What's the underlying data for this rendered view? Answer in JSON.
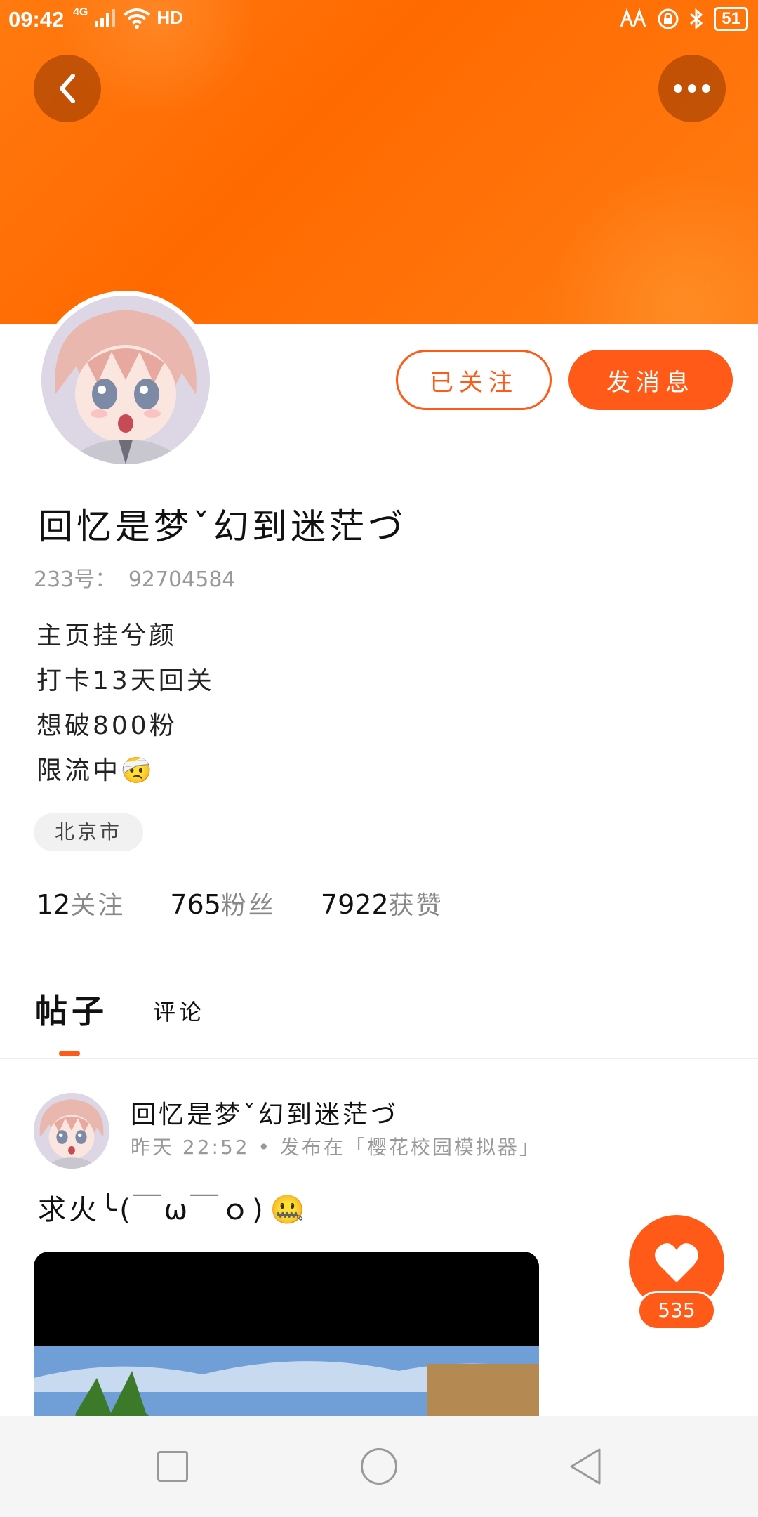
{
  "status_bar": {
    "time": "09:42",
    "network": "4G",
    "hd": "HD",
    "battery": "51",
    "icons": [
      "signal-icon",
      "wifi-icon",
      "nfc-icon",
      "lock-icon",
      "bluetooth-icon",
      "battery-icon"
    ]
  },
  "header": {
    "back_icon": "chevron-left-icon",
    "more_icon": "more-dots-icon",
    "banner_color": "#ff6a00"
  },
  "profile": {
    "follow_button": "已关注",
    "message_button": "发消息",
    "username": "回忆是梦ˇ幻到迷茫づ",
    "uid_label": "233号：",
    "uid_value": "92704584",
    "bio": [
      "主页挂兮颜",
      "打卡13天回关",
      "想破800粉",
      "限流中"
    ],
    "bio_emoji": "🤕",
    "location": "北京市",
    "stats": [
      {
        "num": "12",
        "label": "关注"
      },
      {
        "num": "765",
        "label": "粉丝"
      },
      {
        "num": "7922",
        "label": "获赞"
      }
    ]
  },
  "tabs": {
    "posts": "帖子",
    "comments": "评论",
    "active": "posts"
  },
  "post": {
    "author": "回忆是梦ˇ幻到迷茫づ",
    "meta": "昨天 22:52 • 发布在「樱花校园模拟器」",
    "text": "求火╰(￣ω￣ｏ)",
    "text_emoji": "🤐",
    "likes": "535"
  },
  "nav": {
    "recent": "square-icon",
    "home": "circle-icon",
    "back": "triangle-back-icon"
  },
  "colors": {
    "accent": "#ff5a17",
    "muted_text": "#999999"
  }
}
